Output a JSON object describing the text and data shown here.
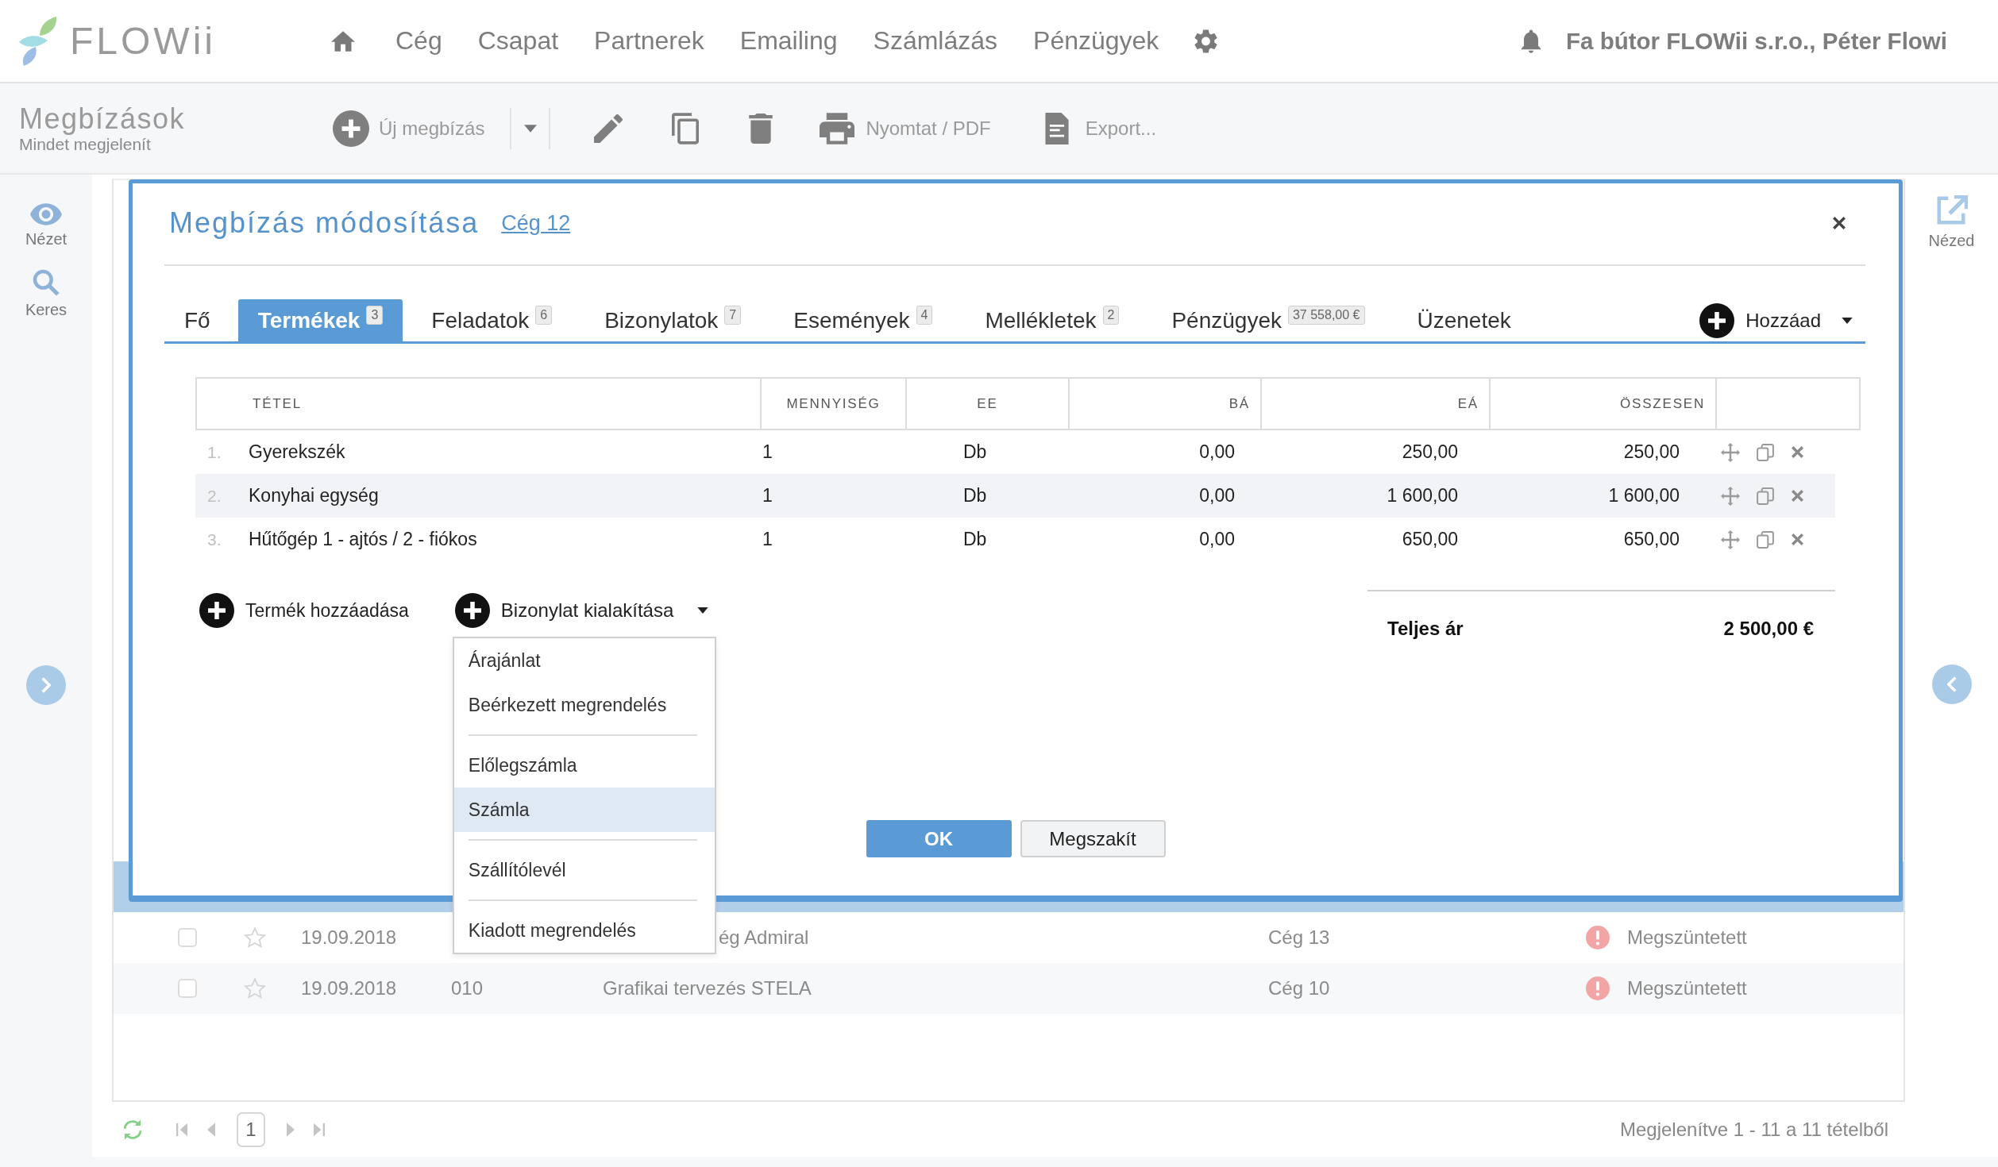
{
  "topbar": {
    "logo": "FLOWii",
    "nav": [
      "Cég",
      "Csapat",
      "Partnerek",
      "Emailing",
      "Számlázás",
      "Pénzügyek"
    ],
    "user": "Fa bútor FLOWii s.r.o., Péter Flowi"
  },
  "toolbar": {
    "title": "Megbízások",
    "subtitle": "Mindet megjelenít",
    "new_button": "Új megbízás",
    "print_button": "Nyomtat / PDF",
    "export_button": "Export..."
  },
  "left_sidebar": [
    {
      "kind": "view",
      "label": "Nézet"
    },
    {
      "kind": "search",
      "label": "Keres"
    }
  ],
  "right_sidebar": {
    "label": "Nézed"
  },
  "list": {
    "rows": [
      {
        "checked": false,
        "starred": false,
        "date": "19.09.2018",
        "description": "ég Admiral",
        "company": "Cég 13",
        "status": "Megszüntetett"
      },
      {
        "checked": false,
        "starred": false,
        "date": "19.09.2018",
        "number": "010",
        "description": "Grafikai tervezés STELA",
        "company": "Cég 10",
        "status": "Megszüntetett"
      }
    ],
    "pagination": {
      "page": "1",
      "summary": "Megjelenítve 1 - 11 a 11 tételből"
    }
  },
  "modal": {
    "title": "Megbízás módosítása",
    "link": "Cég 12",
    "tabs": [
      {
        "label": "Fő",
        "selected": false
      },
      {
        "label": "Termékek",
        "badge": "3",
        "selected": true
      },
      {
        "label": "Feladatok",
        "badge": "6",
        "selected": false
      },
      {
        "label": "Bizonylatok",
        "badge": "7",
        "selected": false
      },
      {
        "label": "Események",
        "badge": "4",
        "selected": false
      },
      {
        "label": "Mellékletek",
        "badge": "2",
        "selected": false
      },
      {
        "label": "Pénzügyek",
        "badge": "37 558,00 €",
        "selected": false
      },
      {
        "label": "Üzenetek",
        "selected": false
      }
    ],
    "add_button": "Hozzáad",
    "table": {
      "columns": [
        "TÉTEL",
        "MENNYISÉG",
        "EE",
        "BÁ",
        "EÁ",
        "ÖSSZESEN"
      ],
      "rows": [
        {
          "number": "1.",
          "name": "Gyerekszék",
          "qty": "1",
          "unit": "Db",
          "ba": "0,00",
          "ea": "250,00",
          "total": "250,00"
        },
        {
          "number": "2.",
          "name": "Konyhai egység",
          "qty": "1",
          "unit": "Db",
          "ba": "0,00",
          "ea": "1 600,00",
          "total": "1 600,00"
        },
        {
          "number": "3.",
          "name": "Hűtőgép 1 - ajtós / 2 - fiókos",
          "qty": "1",
          "unit": "Db",
          "ba": "0,00",
          "ea": "650,00",
          "total": "650,00"
        }
      ]
    },
    "add_product": "Termék hozzáadása",
    "create_document": "Bizonylat kialakítása",
    "total_label": "Teljes ár",
    "total_value": "2 500,00 €",
    "menu": {
      "groups": [
        [
          {
            "label": "Árajánlat",
            "selected": false
          },
          {
            "label": "Beérkezett megrendelés",
            "selected": false
          }
        ],
        [
          {
            "label": "Előlegszámla",
            "selected": false
          },
          {
            "label": "Számla",
            "selected": true
          }
        ],
        [
          {
            "label": "Szállítólevél",
            "selected": false
          }
        ],
        [
          {
            "label": "Kiadott megrendelés",
            "selected": false
          }
        ]
      ]
    },
    "ok_button": "OK",
    "cancel_button": "Megszakít"
  }
}
